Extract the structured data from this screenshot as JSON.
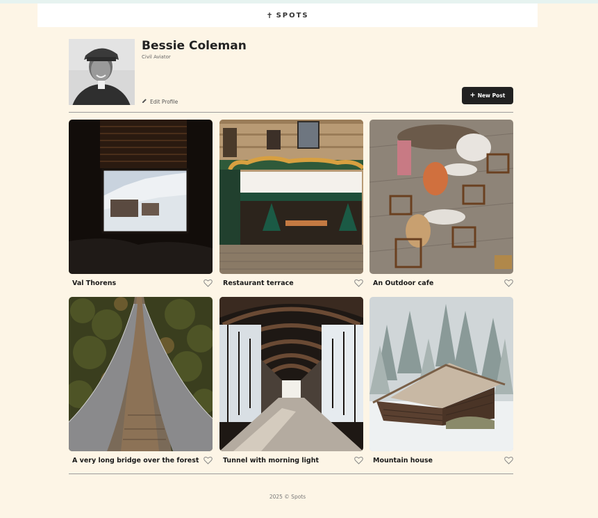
{
  "header": {
    "logo_mark": "✝",
    "logo_text": "SPOTS"
  },
  "profile": {
    "name": "Bessie Coleman",
    "description": "Civil Aviator",
    "edit_label": "Edit Profile",
    "new_post_label": "New Post"
  },
  "cards": [
    {
      "title": "Val Thorens"
    },
    {
      "title": "Restaurant terrace"
    },
    {
      "title": "An Outdoor cafe"
    },
    {
      "title": "A very long bridge over the forest"
    },
    {
      "title": "Tunnel with morning light"
    },
    {
      "title": "Mountain house"
    }
  ],
  "footer": {
    "text": "2025 © Spots"
  }
}
